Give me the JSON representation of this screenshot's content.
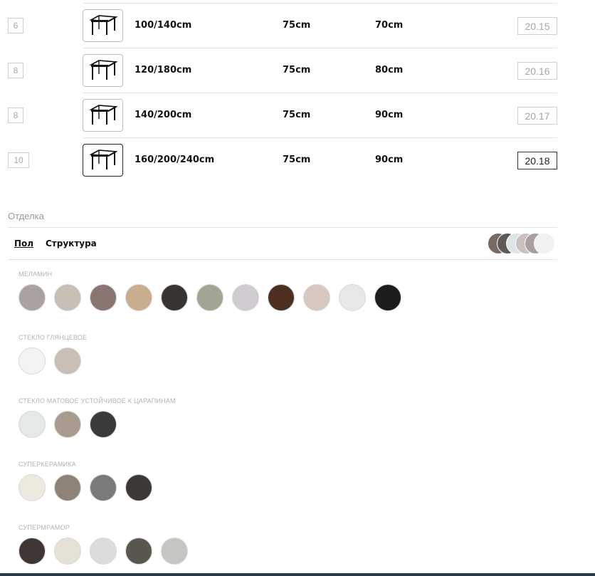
{
  "table": {
    "rows": [
      {
        "seats": "6",
        "size": "100/140cm",
        "height": "75cm",
        "depth": "70cm",
        "code": "20.15",
        "selected": false
      },
      {
        "seats": "8",
        "size": "120/180cm",
        "height": "75cm",
        "depth": "80cm",
        "code": "20.16",
        "selected": false
      },
      {
        "seats": "8",
        "size": "140/200cm",
        "height": "75cm",
        "depth": "90cm",
        "code": "20.17",
        "selected": false
      },
      {
        "seats": "10",
        "size": "160/200/240cm",
        "height": "75cm",
        "depth": "90cm",
        "code": "20.18",
        "selected": true
      }
    ]
  },
  "finish": {
    "title": "Отделка",
    "tabs": [
      {
        "label": "Пол",
        "active": true
      },
      {
        "label": "Структура",
        "active": false
      }
    ],
    "preview_colors": [
      "#7a6a64",
      "#5c5a55",
      "#dfe5e4",
      "#c9c1c0",
      "#a8a09e",
      "#f1f1f1"
    ],
    "groups": [
      {
        "label": "МЕЛАМИН",
        "swatches": [
          "#a9a2a0",
          "#c8bfb4",
          "#8a7670",
          "#c9ad8f",
          "#3a3431",
          "#a3a593",
          "#cfcbd0",
          "#4d2f22",
          "#d8c7bf",
          "#e6e7e6",
          "#1d1d1d"
        ]
      },
      {
        "label": "СТЕКЛО ГЛЯНЦЕВОЕ",
        "swatches": [
          "#f3f3f3",
          "#c9bfb4"
        ]
      },
      {
        "label": "СТЕКЛО МАТОВОЕ УСТОЙЧИВОЕ К ЦАРАПИНАМ",
        "swatches": [
          "#e3e8e8",
          "#a99c8e",
          "#3a3a3a"
        ]
      },
      {
        "label": "СУПЕРКЕРАМИКА",
        "swatches": [
          "#ede9df",
          "#8f8378",
          "#7a7a7a",
          "#3d3835"
        ]
      },
      {
        "label": "СУПЕРМРАМОР",
        "swatches": [
          "#3e3633",
          "#e6e1d6",
          "#dcdcdc",
          "#5a5751",
          "#c7c5c1"
        ]
      }
    ]
  }
}
